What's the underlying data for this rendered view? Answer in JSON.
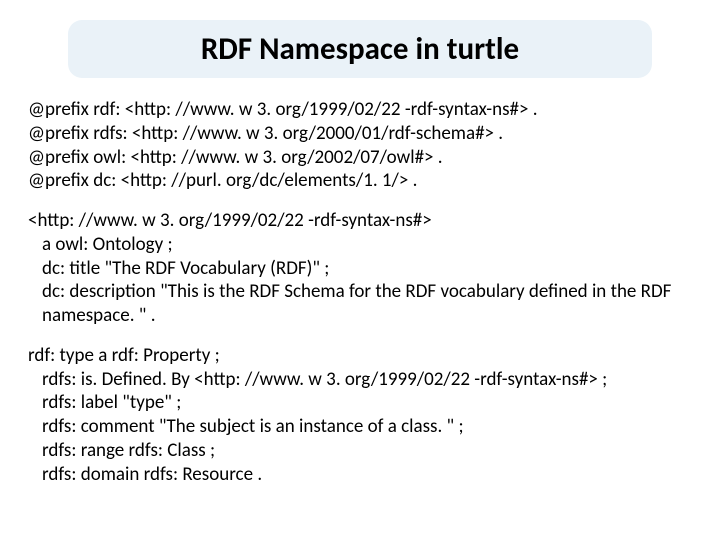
{
  "title": "RDF Namespace in turtle",
  "prefixes": {
    "l1": "@prefix rdf: <http: //www. w 3. org/1999/02/22 -rdf-syntax-ns#> .",
    "l2": "@prefix rdfs: <http: //www. w 3. org/2000/01/rdf-schema#> .",
    "l3": "@prefix owl: <http: //www. w 3. org/2002/07/owl#> .",
    "l4": "@prefix dc: <http: //purl. org/dc/elements/1. 1/> ."
  },
  "ontology": {
    "l1": "<http: //www. w 3. org/1999/02/22 -rdf-syntax-ns#>",
    "l2": "a owl: Ontology ;",
    "l3": "dc: title \"The RDF Vocabulary (RDF)\" ;",
    "l4": "dc: description \"This is the RDF Schema for the RDF vocabulary defined in the RDF",
    "l5": "namespace. \" ."
  },
  "property": {
    "l1": "rdf: type a rdf: Property ;",
    "l2": "rdfs: is. Defined. By <http: //www. w 3. org/1999/02/22 -rdf-syntax-ns#> ;",
    "l3": "rdfs: label \"type\" ;",
    "l4": "rdfs: comment \"The subject is an instance of a class. \" ;",
    "l5": "rdfs: range rdfs: Class ;",
    "l6": "rdfs: domain rdfs: Resource ."
  }
}
